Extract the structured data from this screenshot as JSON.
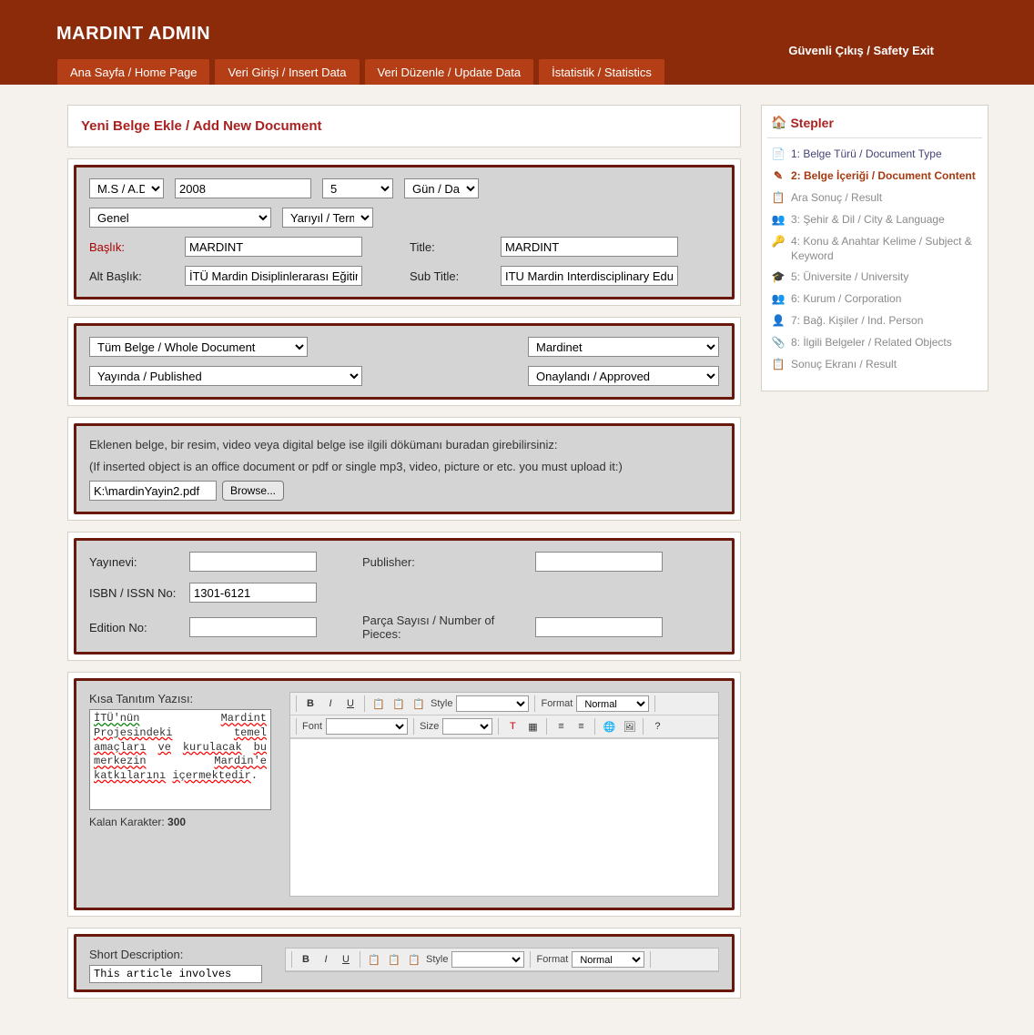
{
  "header": {
    "brand": "MARDINT ADMIN",
    "safety_exit": "Güvenli Çıkış / Safety Exit",
    "nav": [
      "Ana Sayfa / Home Page",
      "Veri Girişi / Insert Data",
      "Veri Düzenle / Update Data",
      "İstatistik / Statistics"
    ]
  },
  "page_title": "Yeni Belge Ekle / Add New Document",
  "date_panel": {
    "era": "M.S / A.D",
    "year": "2008",
    "month": "5",
    "day_label": "Gün / Day",
    "category": "Genel",
    "term_label": "Yarıyıl / Term",
    "baslik_label": "Başlık:",
    "baslik_value": "MARDINT",
    "title_label": "Title:",
    "title_value": "MARDINT",
    "altbaslik_label": "Alt Başlık:",
    "altbaslik_value": "İTÜ Mardin Disiplinlerarası Eğitim",
    "subtitle_label": "Sub Title:",
    "subtitle_value": "ITU Mardin Interdisciplinary Edu"
  },
  "status_panel": {
    "scope": "Tüm Belge / Whole Document",
    "source": "Mardinet",
    "pub_status": "Yayında / Published",
    "approval": "Onaylandı / Approved"
  },
  "upload_panel": {
    "note_tr": "Eklenen belge, bir resim, video veya digital belge ise ilgili dökümanı buradan girebilirsiniz:",
    "note_en": "(If inserted object is an office document or pdf or single mp3, video, picture or etc. you must upload it:)",
    "file_path": "K:\\mardinYayin2.pdf",
    "browse": "Browse..."
  },
  "pub_panel": {
    "yayinevi_label": "Yayınevi:",
    "publisher_label": "Publisher:",
    "isbn_label": "ISBN / ISSN No:",
    "isbn_value": "1301-6121",
    "edition_label": "Edition No:",
    "pieces_label": "Parça Sayısı / Number of Pieces:"
  },
  "intro_panel": {
    "kisa_label": "Kısa Tanıtım Yazısı:",
    "kisa_text": "İTÜ'nün Mardint Projesindeki temel amaçları ve kurulacak bu merkezin Mardin'e katkılarını içermektedir.",
    "kalan_prefix": "Kalan Karakter: ",
    "kalan_count": "300",
    "short_label": "Short Description:",
    "short_text": "This article involves"
  },
  "editor": {
    "style_label": "Style",
    "format_label": "Format",
    "format_value": "Normal",
    "font_label": "Font",
    "size_label": "Size"
  },
  "stepler": {
    "title": "Stepler",
    "items": [
      {
        "label": "1: Belge Türü / Document Type",
        "state": "done"
      },
      {
        "label": "2: Belge İçeriği / Document Content",
        "state": "active"
      },
      {
        "label": "Ara Sonuç / Result",
        "state": "pending"
      },
      {
        "label": "3: Şehir & Dil / City & Language",
        "state": "pending"
      },
      {
        "label": "4: Konu & Anahtar Kelime / Subject & Keyword",
        "state": "pending"
      },
      {
        "label": "5: Üniversite / University",
        "state": "pending"
      },
      {
        "label": "6: Kurum / Corporation",
        "state": "pending"
      },
      {
        "label": "7: Bağ. Kişiler / Ind. Person",
        "state": "pending"
      },
      {
        "label": "8: İlgili Belgeler / Related Objects",
        "state": "pending"
      },
      {
        "label": "Sonuç Ekranı / Result",
        "state": "pending"
      }
    ]
  }
}
